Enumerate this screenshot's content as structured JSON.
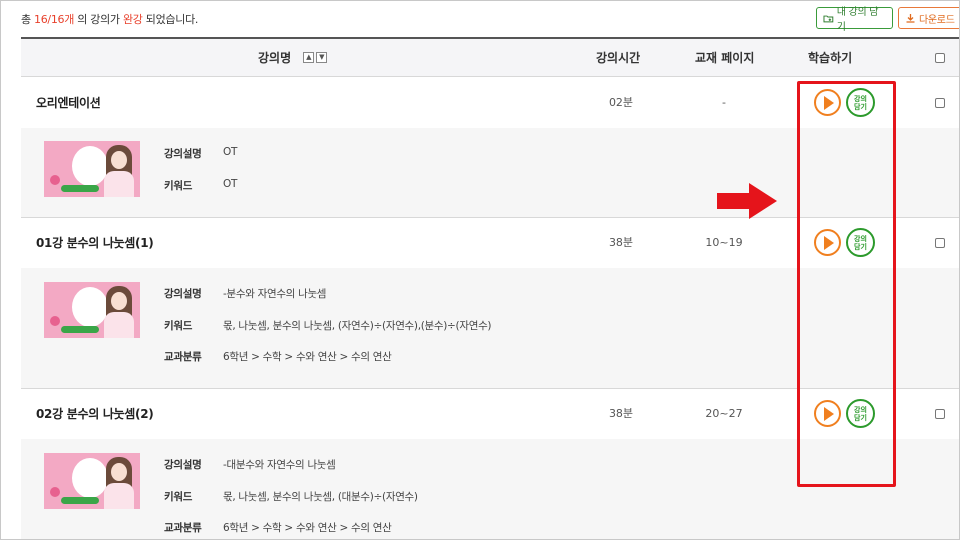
{
  "summary": {
    "prefix": "총",
    "count": "16/16개",
    "middle": "의 강의가",
    "status": "완강",
    "suffix": "되었습니다."
  },
  "buttons": {
    "my_lecture": "내 강의 담기",
    "download": "다운로드"
  },
  "table_header": {
    "name": "강의명",
    "time": "강의시간",
    "page": "교재 페이지",
    "learn": "학습하기"
  },
  "action_labels": {
    "keep": "강의 담기"
  },
  "info_labels": {
    "description": "강의설명",
    "keyword": "키워드",
    "category": "교과분류"
  },
  "lectures": [
    {
      "title": "오리엔테이션",
      "time": "02분",
      "page": "-",
      "description": "OT",
      "keyword": "OT",
      "category": ""
    },
    {
      "title": "01강 분수의 나눗셈(1)",
      "time": "38분",
      "page": "10~19",
      "description": "-분수와 자연수의 나눗셈",
      "keyword": "몫, 나눗셈, 분수의 나눗셈, (자연수)÷(자연수),(분수)÷(자연수)",
      "category": "6학년 > 수학 > 수와 연산 > 수의 연산"
    },
    {
      "title": "02강 분수의 나눗셈(2)",
      "time": "38분",
      "page": "20~27",
      "description": "-대분수와 자연수의 나눗셈",
      "keyword": "몫, 나눗셈, 분수의 나눗셈, (대분수)÷(자연수)",
      "category": "6학년 > 수학 > 수와 연산 > 수의 연산"
    }
  ],
  "colors": {
    "highlight": "#e8412c",
    "play": "#f07f1f",
    "keep": "#2c9a2c",
    "annotation": "#e5141b"
  }
}
